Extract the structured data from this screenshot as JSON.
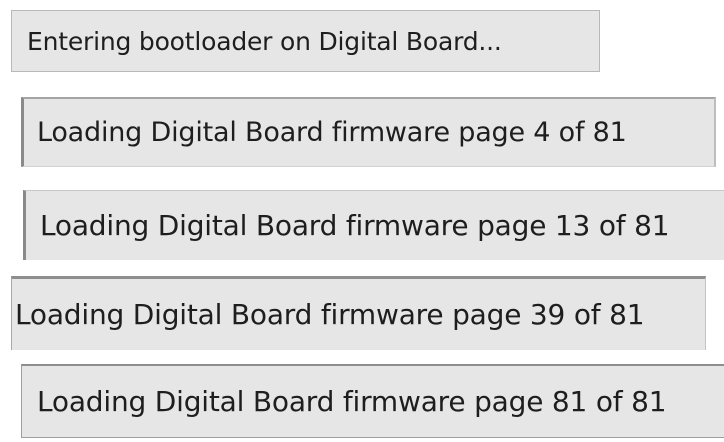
{
  "status_messages": [
    {
      "text": "Entering bootloader on Digital Board..."
    },
    {
      "text": "Loading Digital Board firmware page 4 of 81",
      "current_page": 4,
      "total_pages": 81
    },
    {
      "text": "Loading Digital Board firmware page 13 of 81",
      "current_page": 13,
      "total_pages": 81
    },
    {
      "text": "Loading Digital Board firmware page 39 of 81",
      "current_page": 39,
      "total_pages": 81
    },
    {
      "text": "Loading Digital Board firmware page 81 of 81",
      "current_page": 81,
      "total_pages": 81
    }
  ],
  "colors": {
    "bar_background": "#e6e6e6",
    "text": "#1e1e1e",
    "border": "#8a8a8a"
  }
}
